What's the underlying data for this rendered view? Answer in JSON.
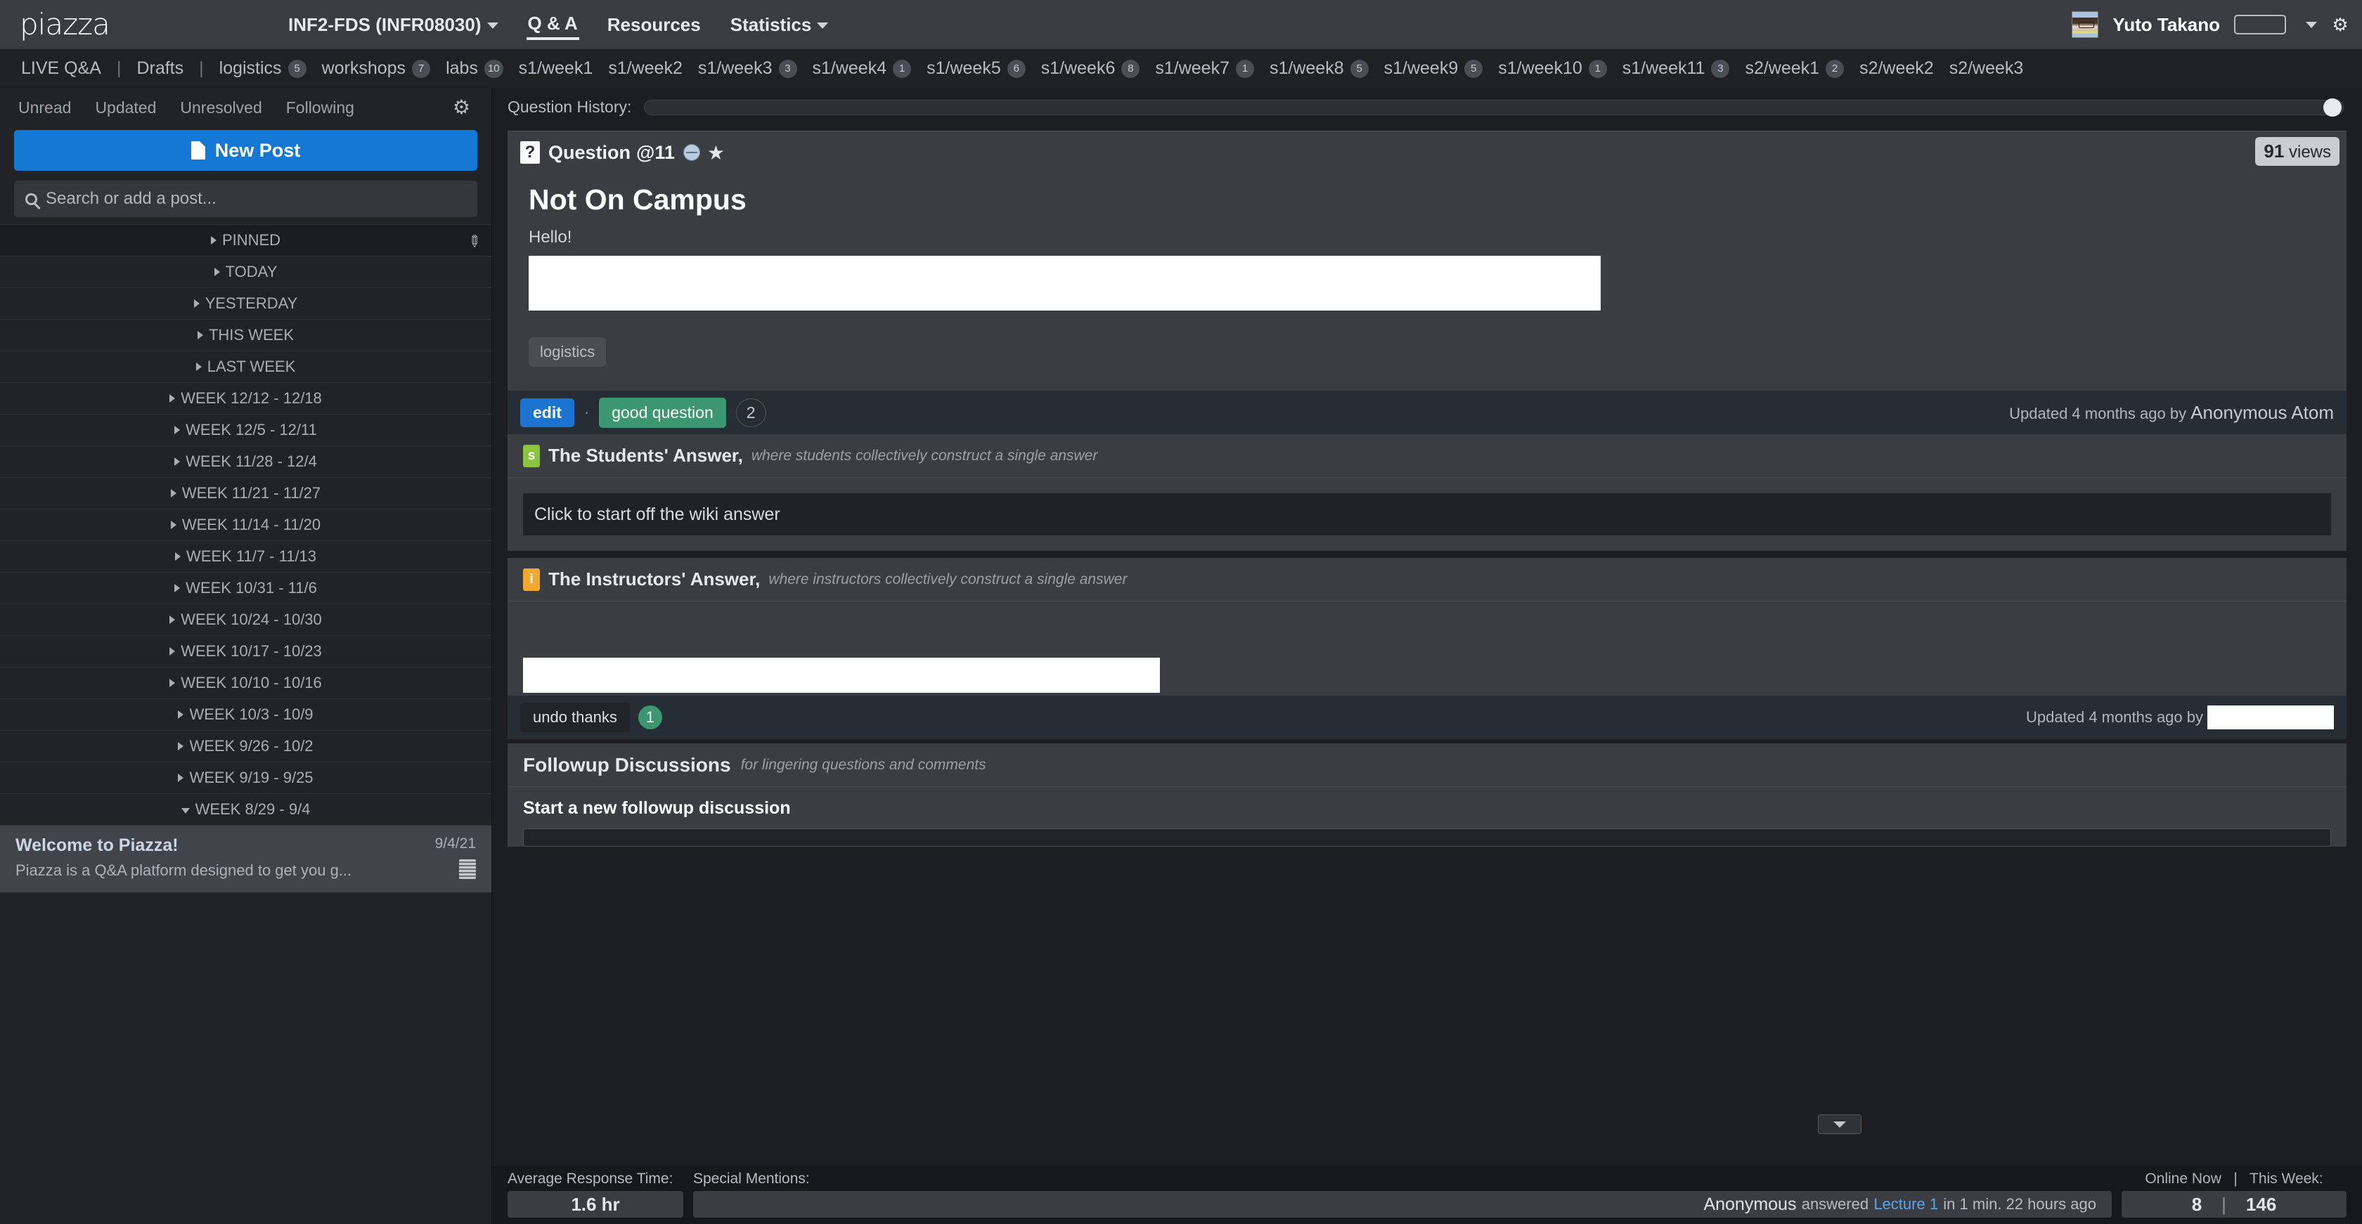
{
  "topbar": {
    "logo": "piazza",
    "nav": [
      {
        "label": "INF2-FDS (INFR08030)",
        "caret": true,
        "active": false
      },
      {
        "label": "Q & A",
        "caret": false,
        "active": true
      },
      {
        "label": "Resources",
        "caret": false,
        "active": false
      },
      {
        "label": "Statistics",
        "caret": true,
        "active": false
      }
    ],
    "username": "Yuto Takano",
    "avatar_icon": "user-avatar",
    "status_caret_icon": "chevron-down-icon",
    "gear_icon": "gear-icon"
  },
  "folderbar": {
    "tabs": [
      {
        "label": "LIVE Q&A",
        "count": null
      },
      {
        "label": "Drafts",
        "count": null
      },
      {
        "label": "logistics",
        "count": "5"
      },
      {
        "label": "workshops",
        "count": "7"
      },
      {
        "label": "labs",
        "count": "10"
      },
      {
        "label": "s1/week1",
        "count": null
      },
      {
        "label": "s1/week2",
        "count": null
      },
      {
        "label": "s1/week3",
        "count": "3"
      },
      {
        "label": "s1/week4",
        "count": "1"
      },
      {
        "label": "s1/week5",
        "count": "6"
      },
      {
        "label": "s1/week6",
        "count": "8"
      },
      {
        "label": "s1/week7",
        "count": "1"
      },
      {
        "label": "s1/week8",
        "count": "5"
      },
      {
        "label": "s1/week9",
        "count": "5"
      },
      {
        "label": "s1/week10",
        "count": "1"
      },
      {
        "label": "s1/week11",
        "count": "3"
      },
      {
        "label": "s2/week1",
        "count": "2"
      },
      {
        "label": "s2/week2",
        "count": null
      },
      {
        "label": "s2/week3",
        "count": null
      }
    ]
  },
  "sidebar": {
    "filters": [
      "Unread",
      "Updated",
      "Unresolved",
      "Following"
    ],
    "filter_gear_icon": "gear-icon",
    "new_post_label": "New Post",
    "new_post_icon": "new-document-icon",
    "search_placeholder": "Search or add a post...",
    "search_icon": "search-icon",
    "pin_icon": "pin-icon",
    "folders": [
      {
        "label": "PINNED",
        "open": false,
        "pinned": true
      },
      {
        "label": "TODAY",
        "open": false,
        "pinned": false
      },
      {
        "label": "YESTERDAY",
        "open": false,
        "pinned": false
      },
      {
        "label": "THIS WEEK",
        "open": false,
        "pinned": false
      },
      {
        "label": "LAST WEEK",
        "open": false,
        "pinned": false
      },
      {
        "label": "WEEK 12/12 - 12/18",
        "open": false,
        "pinned": false
      },
      {
        "label": "WEEK 12/5 - 12/11",
        "open": false,
        "pinned": false
      },
      {
        "label": "WEEK 11/28 - 12/4",
        "open": false,
        "pinned": false
      },
      {
        "label": "WEEK 11/21 - 11/27",
        "open": false,
        "pinned": false
      },
      {
        "label": "WEEK 11/14 - 11/20",
        "open": false,
        "pinned": false
      },
      {
        "label": "WEEK 11/7 - 11/13",
        "open": false,
        "pinned": false
      },
      {
        "label": "WEEK 10/31 - 11/6",
        "open": false,
        "pinned": false
      },
      {
        "label": "WEEK 10/24 - 10/30",
        "open": false,
        "pinned": false
      },
      {
        "label": "WEEK 10/17 - 10/23",
        "open": false,
        "pinned": false
      },
      {
        "label": "WEEK 10/10 - 10/16",
        "open": false,
        "pinned": false
      },
      {
        "label": "WEEK 10/3 - 10/9",
        "open": false,
        "pinned": false
      },
      {
        "label": "WEEK 9/26 - 10/2",
        "open": false,
        "pinned": false
      },
      {
        "label": "WEEK 9/19 - 9/25",
        "open": false,
        "pinned": false
      },
      {
        "label": "WEEK 8/29 - 9/4",
        "open": true,
        "pinned": false
      }
    ],
    "post": {
      "title": "Welcome to Piazza!",
      "snippet": "Piazza is a Q&A platform designed to get you g...",
      "date": "9/4/21",
      "badge_icon": "note-lines-icon"
    }
  },
  "main": {
    "question_history_label": "Question History:",
    "question": {
      "marker_icon": "question-mark-icon",
      "head_label": "Question",
      "number": "@11",
      "visibility_icon": "globe-icon",
      "star_icon": "star-icon",
      "views_count": "91",
      "views_label": "views",
      "title": "Not On Campus",
      "body_text": "Hello!",
      "tags": [
        "logistics"
      ],
      "edit_label": "edit",
      "separator": "·",
      "good_question_label": "good question",
      "good_question_count": "2",
      "updated_prefix": "Updated 4 months ago by",
      "updated_by": "Anonymous Atom"
    },
    "students_answer": {
      "chip": "s",
      "title": "The Students' Answer,",
      "subtitle": "where students collectively construct a single answer",
      "placeholder": "Click to start off the wiki answer"
    },
    "instructors_answer": {
      "chip": "i",
      "title": "The Instructors' Answer,",
      "subtitle": "where instructors collectively construct a single answer",
      "undo_label": "undo thanks",
      "undo_count": "1",
      "updated_prefix": "Updated 4 months ago by"
    },
    "followup": {
      "title": "Followup Discussions",
      "subtitle": "for lingering questions and comments",
      "start_label": "Start a new followup discussion",
      "expand_icon": "chevron-down-icon"
    }
  },
  "bottombar": {
    "avg_response_label": "Average Response Time:",
    "avg_response_value": "1.6 hr",
    "special_mentions_label": "Special Mentions:",
    "mention_name": "Anonymous",
    "mention_verb": "answered",
    "mention_link": "Lecture 1",
    "mention_tail": "in 1 min. 22 hours ago",
    "online_label": "Online Now",
    "online_sep": "|",
    "week_label": "This Week:",
    "online_value": "8",
    "week_value": "146"
  }
}
